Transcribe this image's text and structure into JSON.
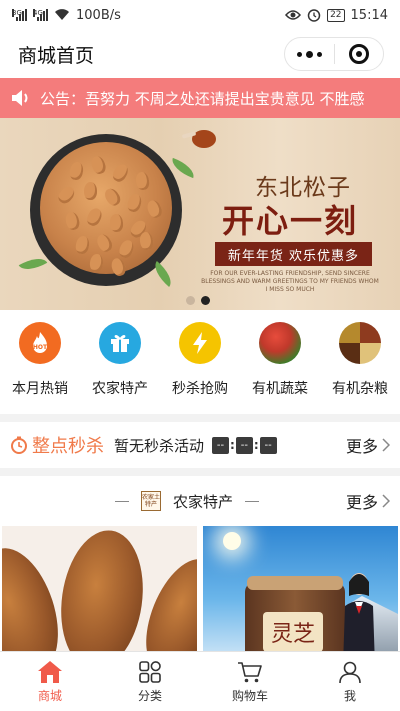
{
  "status_bar": {
    "network_speed": "100B/s",
    "battery": "22",
    "time": "15:14",
    "icons": [
      "signal-3g-icon",
      "signal-4g-icon",
      "wifi-icon",
      "eye-icon",
      "alarm-icon",
      "battery-icon"
    ]
  },
  "header": {
    "title": "商城首页",
    "menu_icon": "more-dots-icon",
    "close_icon": "target-circle-icon"
  },
  "notice": {
    "icon": "speaker-icon",
    "text": "公告：吾努力 不周之处还请提出宝贵意见 不胜感"
  },
  "banner": {
    "headline": "东北松子",
    "title": "开心一刻",
    "slogan": "新年年货  欢乐优惠多",
    "fine_print": "FOR OUR EVER-LASTING FRIENDSHIP, SEND SINCERE BLESSINGS AND WARM GREETINGS TO MY FRIENDS WHOM I MISS SO MUCH",
    "slides": 2,
    "active_slide": 2
  },
  "categories": [
    {
      "label": "本月热销",
      "icon": "hot-icon",
      "color": "#f26b21"
    },
    {
      "label": "农家特产",
      "icon": "gift-icon",
      "color": "#27a8e0"
    },
    {
      "label": "秒杀抢购",
      "icon": "lightning-icon",
      "color": "#f5c400"
    },
    {
      "label": "有机蔬菜",
      "icon": "vegetables-icon",
      "color": "#c0392b"
    },
    {
      "label": "有机杂粮",
      "icon": "grains-icon",
      "color": "#8e3b1f"
    }
  ],
  "flash_sale": {
    "title": "整点秒杀",
    "status": "暂无秒杀活动",
    "countdown": [
      "--",
      "--",
      "--"
    ],
    "more": "更多"
  },
  "section": {
    "logo_text": "农家土特产",
    "title": "农家特产",
    "more": "更多"
  },
  "tabbar": [
    {
      "label": "商城",
      "icon": "home-icon",
      "active": true
    },
    {
      "label": "分类",
      "icon": "grid-icon",
      "active": false
    },
    {
      "label": "购物车",
      "icon": "cart-icon",
      "active": false
    },
    {
      "label": "我",
      "icon": "user-icon",
      "active": false
    }
  ],
  "colors": {
    "accent": "#f05a4a",
    "notice_bg": "#f47c7c",
    "flash_title": "#f07a4a"
  }
}
